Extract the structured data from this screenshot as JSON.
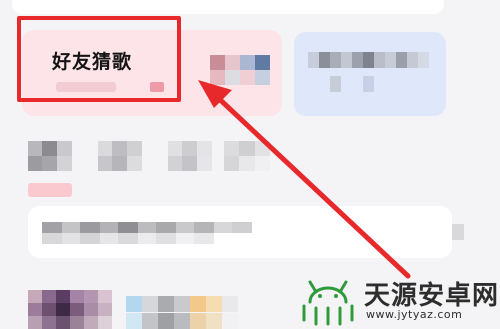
{
  "cards": {
    "featured_title": "好友猜歌"
  },
  "watermark": {
    "site_name": "天源安卓网",
    "url": "www.jytyaz.com",
    "icon": "android-robot-icon"
  },
  "colors": {
    "highlight": "#e8292b",
    "pink_card": "#fde4e8",
    "blue_card": "#dfe7fb",
    "background": "#f4f4f6",
    "watermark_green": "#2f9a3a"
  }
}
